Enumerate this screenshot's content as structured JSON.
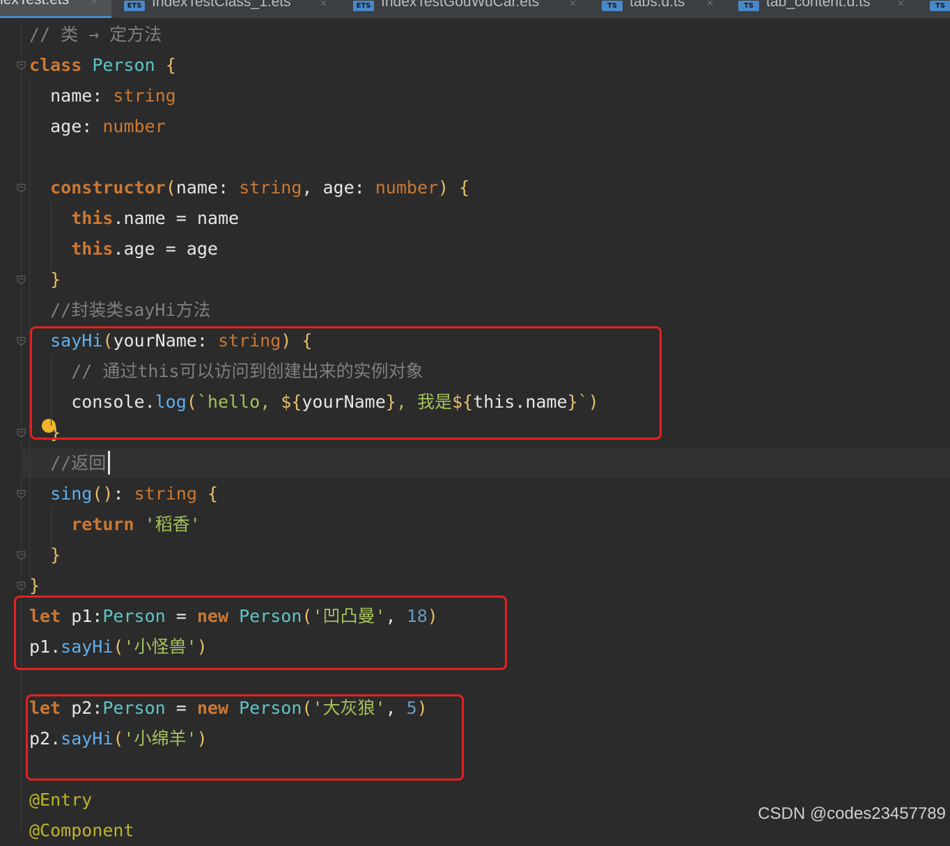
{
  "tabs": [
    {
      "label": "lexTest.ets",
      "active": true,
      "icon": "",
      "icon_color": ""
    },
    {
      "label": "IndexTestClass_1.ets",
      "active": false,
      "icon": "ETS",
      "icon_color": "#4a88c7"
    },
    {
      "label": "IndexTestGouWuCar.ets",
      "active": false,
      "icon": "ETS",
      "icon_color": "#4a88c7"
    },
    {
      "label": "tabs.d.ts",
      "active": false,
      "icon": "TS",
      "icon_color": "#4a88c7"
    },
    {
      "label": "tab_content.d.ts",
      "active": false,
      "icon": "TS",
      "icon_color": "#4a88c7"
    },
    {
      "label": "",
      "active": false,
      "icon": "TS",
      "icon_color": "#4a88c7"
    }
  ],
  "code": {
    "lines": [
      {
        "text": "// 类 → 定方法"
      },
      {
        "text": "class Person {"
      },
      {
        "text": "  name: string"
      },
      {
        "text": "  age: number"
      },
      {
        "text": ""
      },
      {
        "text": "  constructor(name: string, age: number) {"
      },
      {
        "text": "    this.name = name"
      },
      {
        "text": "    this.age = age"
      },
      {
        "text": "  }"
      },
      {
        "text": "  //封装类sayHi方法"
      },
      {
        "text": "  sayHi(yourName: string) {"
      },
      {
        "text": "    // 通过this可以访问到创建出来的实例对象"
      },
      {
        "text": "    console.log(`hello, ${yourName}, 我是${this.name}`)"
      },
      {
        "text": "  }"
      },
      {
        "text": "  //返回"
      },
      {
        "text": "  sing(): string {"
      },
      {
        "text": "    return '稻香'"
      },
      {
        "text": "  }"
      },
      {
        "text": "}"
      },
      {
        "text": "let p1:Person = new Person('凹凸曼', 18)"
      },
      {
        "text": "p1.sayHi('小怪兽')"
      },
      {
        "text": ""
      },
      {
        "text": "let p2:Person = new Person('大灰狼', 5)"
      },
      {
        "text": "p2.sayHi('小绵羊')"
      },
      {
        "text": ""
      },
      {
        "text": "@Entry"
      },
      {
        "text": "@Component"
      }
    ]
  },
  "colors": {
    "background": "#2b2b2b",
    "tab_bar": "#3c3f41",
    "active_tab_underline": "#4a88c7",
    "keyword": "#cc7832",
    "class_name": "#5fc5c5",
    "function": "#61afef",
    "string": "#a5c25c",
    "comment": "#7f7f7f",
    "highlight_box": "#e62020",
    "intention_bulb": "#f0b429"
  },
  "watermark": "CSDN @codes23457789"
}
